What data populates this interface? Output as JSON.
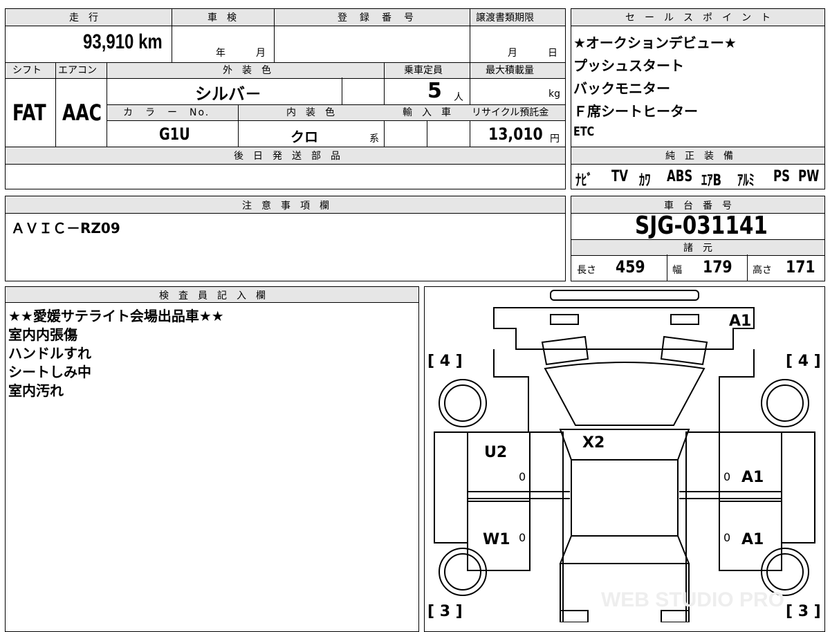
{
  "top_left": {
    "headers": {
      "mileage": "走　行",
      "inspection": "車　検",
      "registration": "登　録　番　号",
      "transfer_deadline": "譲渡書類期限"
    },
    "mileage_value": "93,910 km",
    "inspection_year": "年",
    "inspection_month": "月",
    "transfer_month": "月",
    "transfer_day": "日",
    "headers2": {
      "shift": "シフト",
      "aircon": "エアコン",
      "exterior_color": "外　装　色",
      "capacity": "乗車定員",
      "max_load": "最大積載量"
    },
    "shift_value": "FAT",
    "aircon_value": "AAC",
    "exterior_color_value": "シルバ－",
    "capacity_value": "5",
    "capacity_unit": "人",
    "max_load_unit": "kg",
    "headers3": {
      "color_no": "カ　ラ　ー　No.",
      "interior_color": "内　装　色",
      "import": "輸　入　車",
      "recycle": "リサイクル預託金"
    },
    "color_no_value": "G1U",
    "interior_color_value": "クロ",
    "interior_color_suffix": "系",
    "recycle_value": "13,010",
    "recycle_unit": "円",
    "later_parts_header": "後　日　発　送　部　品"
  },
  "sales_points": {
    "header": "セ　ー　ル　ス　ポ　イ　ン　ト",
    "items": [
      "★オークションデビュー★",
      "プッシュスタート",
      "バックモニター",
      "Ｆ席シートヒーター",
      "ETC"
    ]
  },
  "equipment": {
    "header": "純　正　装　備",
    "items": [
      "ﾅﾋﾞ",
      "TV",
      "ｶﾜ",
      "ABS",
      "ｴｱB",
      "ｱﾙﾐ",
      "PS",
      "PW"
    ]
  },
  "notes": {
    "header": "注　意　事　項　欄",
    "text": "ＡＶＩＣ－RZ09"
  },
  "chassis": {
    "header": "車　台　番　号",
    "value": "SJG-031141"
  },
  "specs": {
    "header": "諸　元",
    "length_label": "長さ",
    "length": "459",
    "width_label": "幅",
    "width": "179",
    "height_label": "高さ",
    "height": "171"
  },
  "inspector": {
    "header": "検　査　員　記　入　欄",
    "lines": [
      "★★愛媛サテライト会場出品車★★",
      "室内内張傷",
      "ハンドルすれ",
      "シートしみ中",
      "室内汚れ"
    ]
  },
  "diagram": {
    "tire_fl": "[ 4 ]",
    "tire_fr": "[ 4 ]",
    "tire_rl": "[ 3 ]",
    "tire_rr": "[ 3 ]",
    "marks": {
      "hood_top": "A1",
      "roof": "X2",
      "left_front_door": "U2",
      "left_rear_door": "W1",
      "right_front_door": "A1",
      "right_rear_door": "A1"
    },
    "zero": "0",
    "watermark": "WEB STUDIO PRO"
  }
}
